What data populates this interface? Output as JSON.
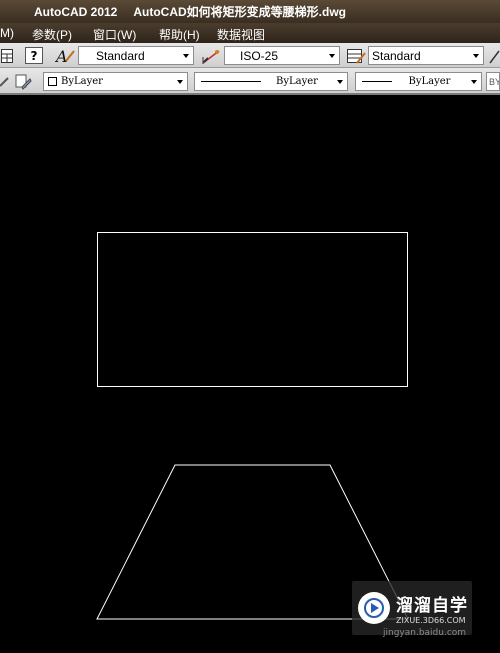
{
  "window": {
    "app_name": "AutoCAD 2012",
    "document_title": "AutoCAD如何将矩形变成等腰梯形.dwg"
  },
  "menu": {
    "items": [
      {
        "label": "M)"
      },
      {
        "label": "参数(P)"
      },
      {
        "label": "窗口(W)"
      },
      {
        "label": "帮助(H)"
      },
      {
        "label": "数据视图"
      }
    ]
  },
  "toolbar_styles": {
    "text_style": "Standard",
    "dim_style": "ISO-25",
    "table_style": "Standard",
    "help_glyph": "?"
  },
  "toolbar_properties": {
    "color": "ByLayer",
    "linetype": "ByLayer",
    "lineweight": "ByLayer",
    "plotstyle": "BY"
  },
  "drawing": {
    "background": "#000000",
    "stroke": "#ffffff"
  },
  "watermark": {
    "brand": "溜溜自学",
    "domain": "ZIXUE.3D66.COM",
    "site": "jingyan.baidu.com"
  }
}
